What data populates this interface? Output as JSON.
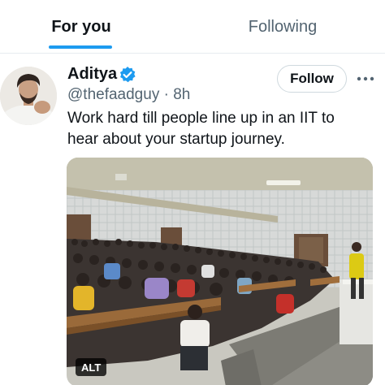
{
  "tabs": [
    {
      "label": "For you",
      "active": true
    },
    {
      "label": "Following",
      "active": false
    }
  ],
  "tweet": {
    "author_name": "Aditya",
    "handle": "@thefaadguy",
    "time": "8h",
    "meta_separator": "·",
    "follow_label": "Follow",
    "body_line1": "Work hard till people line up in an IIT to",
    "body_line2": "hear about your startup journey.",
    "media_alt_label": "ALT"
  },
  "icons": {
    "verified": "verified-badge-icon",
    "more": "more-options-icon"
  },
  "colors": {
    "accent": "#1d9bf0",
    "text_primary": "#0f1419",
    "text_secondary": "#536471",
    "border": "#cfd9de"
  }
}
